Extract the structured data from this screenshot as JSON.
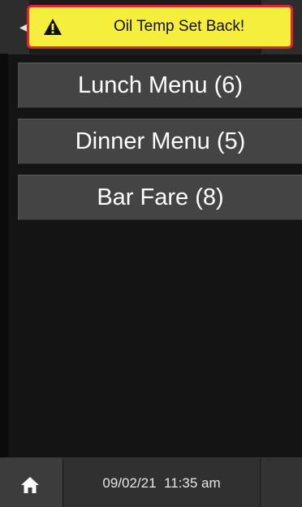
{
  "alert": {
    "icon": "warning-triangle-icon",
    "message": "Oil Temp Set Back!",
    "background_color": "#f6ee3c",
    "border_color": "#e2262a"
  },
  "header": {
    "back_icon": "chevron-left-icon"
  },
  "menus": [
    {
      "label": "Lunch Menu (6)"
    },
    {
      "label": "Dinner Menu (5)"
    },
    {
      "label": "Bar Fare (8)"
    }
  ],
  "footer": {
    "home_icon": "home-icon",
    "datetime": "09/02/21  11:35 am"
  }
}
